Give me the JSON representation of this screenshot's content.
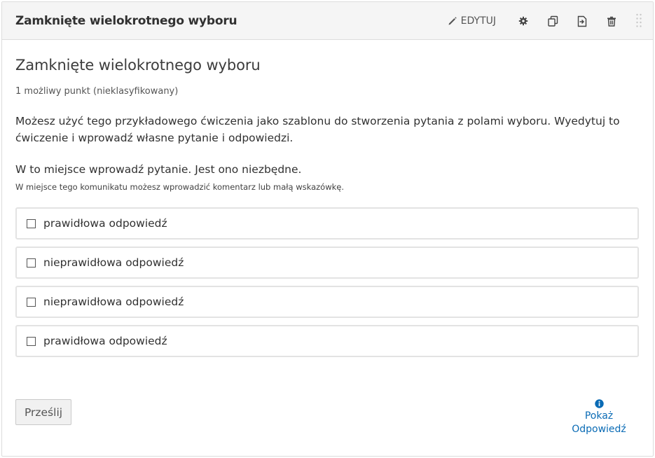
{
  "header": {
    "title": "Zamknięte wielokrotnego wyboru",
    "edit_label": "EDYTUJ",
    "icons": [
      "pencil-icon",
      "gear-icon",
      "duplicate-icon",
      "move-icon",
      "trash-icon",
      "drag-handle-icon"
    ]
  },
  "problem": {
    "title": "Zamknięte wielokrotnego wyboru",
    "points": "1 możliwy punkt (nieklasyfikowany)",
    "description": "Możesz użyć tego przykładowego ćwiczenia jako szablonu do stworzenia pytania z polami wyboru. Wyedytuj to ćwiczenie i wprowadź własne pytanie i odpowiedzi.",
    "question": "W to miejsce wprowadź pytanie. Jest ono niezbędne.",
    "hint": "W miejsce tego komunikatu możesz wprowadzić komentarz lub małą wskazówkę."
  },
  "choices": [
    {
      "label": "prawidłowa odpowiedź",
      "checked": false
    },
    {
      "label": "nieprawidłowa odpowiedź",
      "checked": false
    },
    {
      "label": "nieprawidłowa odpowiedź",
      "checked": false
    },
    {
      "label": "prawidłowa odpowiedź",
      "checked": false
    }
  ],
  "footer": {
    "submit_label": "Prześlij",
    "show_answer_line1": "Pokaż",
    "show_answer_line2": "Odpowiedź"
  },
  "colors": {
    "header_bg": "#f5f5f5",
    "link": "#0a6bb5",
    "border": "#dcdcdc"
  }
}
